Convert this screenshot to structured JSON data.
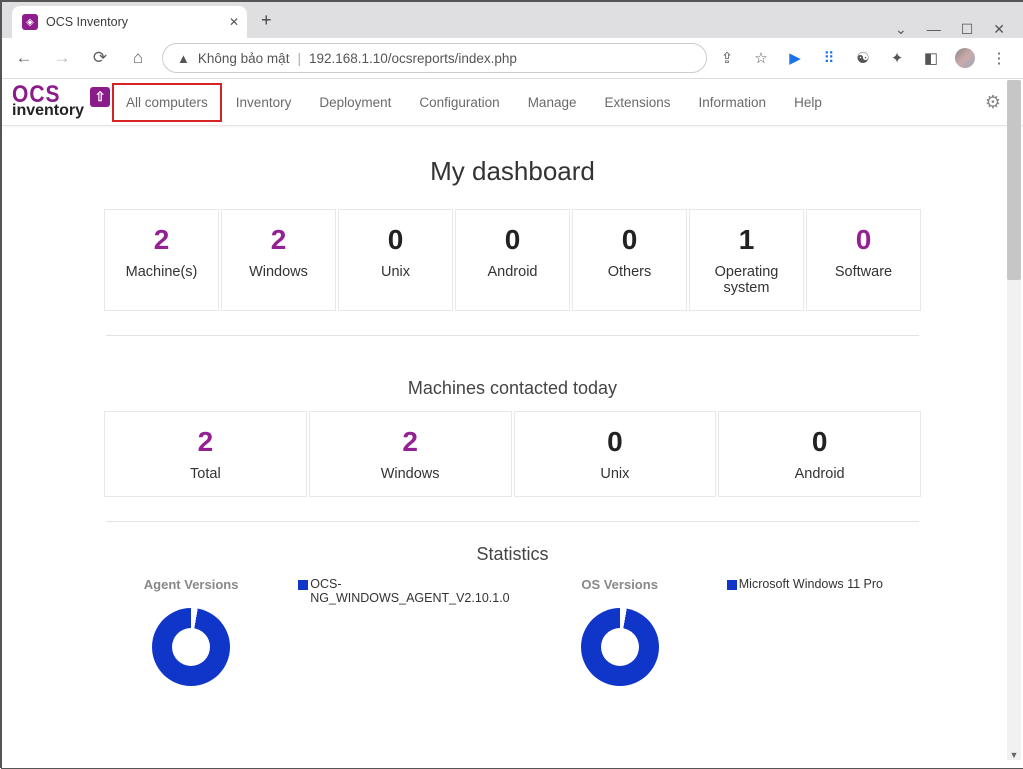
{
  "browser": {
    "tab_title": "OCS Inventory",
    "not_secure": "Không bảo mật",
    "url": "192.168.1.10/ocsreports/index.php"
  },
  "nav": {
    "items": [
      "All computers",
      "Inventory",
      "Deployment",
      "Configuration",
      "Manage",
      "Extensions",
      "Information",
      "Help"
    ],
    "active_index": 0
  },
  "page": {
    "title": "My dashboard",
    "summary": [
      {
        "value": "2",
        "label": "Machine(s)",
        "color": "purple"
      },
      {
        "value": "2",
        "label": "Windows",
        "color": "purple"
      },
      {
        "value": "0",
        "label": "Unix",
        "color": "black"
      },
      {
        "value": "0",
        "label": "Android",
        "color": "black"
      },
      {
        "value": "0",
        "label": "Others",
        "color": "black"
      },
      {
        "value": "1",
        "label": "Operating system",
        "color": "black"
      },
      {
        "value": "0",
        "label": "Software",
        "color": "purple"
      }
    ],
    "contacted_title": "Machines contacted today",
    "contacted": [
      {
        "value": "2",
        "label": "Total",
        "color": "purple"
      },
      {
        "value": "2",
        "label": "Windows",
        "color": "purple"
      },
      {
        "value": "0",
        "label": "Unix",
        "color": "black"
      },
      {
        "value": "0",
        "label": "Android",
        "color": "black"
      }
    ],
    "stats_title": "Statistics",
    "agent_versions_label": "Agent Versions",
    "agent_legend": "OCS-NG_WINDOWS_AGENT_V2.10.1.0",
    "os_versions_label": "OS Versions",
    "os_legend": "Microsoft Windows 11 Pro"
  },
  "chart_data": [
    {
      "type": "pie",
      "title": "Agent Versions",
      "series": [
        {
          "name": "OCS-NG_WINDOWS_AGENT_V2.10.1.0",
          "value": 100
        }
      ]
    },
    {
      "type": "pie",
      "title": "OS Versions",
      "series": [
        {
          "name": "Microsoft Windows 11 Pro",
          "value": 100
        }
      ]
    }
  ]
}
